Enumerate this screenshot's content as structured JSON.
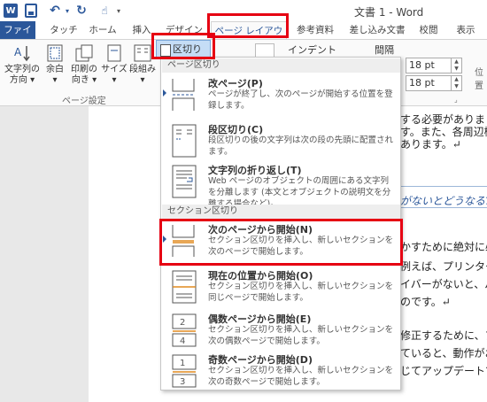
{
  "window": {
    "title": "文書 1 - Word"
  },
  "quick_access": {
    "undo_icon": "undo-icon",
    "redo_icon": "redo-icon",
    "touch_icon": "touch-mode-icon"
  },
  "tabs": [
    {
      "label": "ファイル"
    },
    {
      "label": "タッチ"
    },
    {
      "label": "ホーム"
    },
    {
      "label": "挿入"
    },
    {
      "label": "デザイン"
    },
    {
      "label": "ページ レイアウト"
    },
    {
      "label": "参考資料"
    },
    {
      "label": "差し込み文書"
    },
    {
      "label": "校閲"
    },
    {
      "label": "表示"
    }
  ],
  "ribbon": {
    "text_direction": [
      "文字列の",
      "方向"
    ],
    "margins": "余白",
    "orientation": [
      "印刷の",
      "向き"
    ],
    "size": "サイズ",
    "columns": "段組み",
    "group_label": "ページ設定",
    "breaks_button": "区切り",
    "indent_label": "インデント",
    "spacing_label": "間隔",
    "spacing_before": "18 pt",
    "spacing_after": "18 pt",
    "position_label": "位置"
  },
  "dropdown": {
    "section_page": "ページ区切り",
    "section_section": "セクション区切り",
    "items": [
      {
        "title": "改ページ(P)",
        "desc": "ページが終了し、次のページが開始する位置を登録します。"
      },
      {
        "title": "段区切り(C)",
        "desc": "段区切りの後の文字列は次の段の先頭に配置されます。"
      },
      {
        "title": "文字列の折り返し(T)",
        "desc": "Web ページのオブジェクトの周囲にある文字列を分離します (本文とオブジェクトの説明文を分離する場合など)。"
      },
      {
        "title": "次のページから開始(N)",
        "desc": "セクション区切りを挿入し、新しいセクションを次のページで開始します。"
      },
      {
        "title": "現在の位置から開始(O)",
        "desc": "セクション区切りを挿入し、新しいセクションを同じページで開始します。"
      },
      {
        "title": "偶数ページから開始(E)",
        "desc": "セクション区切りを挿入し、新しいセクションを次の偶数ページで開始します。"
      },
      {
        "title": "奇数ページから開始(D)",
        "desc": "セクション区切りを挿入し、新しいセクションを次の奇数ページで開始します。"
      }
    ]
  },
  "document": {
    "lines": [
      "する必要がありま",
      "す。また、各周辺機",
      "あります。↵",
      "かすために絶対に必",
      "例えば、プリンター",
      "イバーがないと、パ",
      "のです。↵",
      "修正するために、ア",
      "ていると、動作がお",
      "じてアップデートで"
    ],
    "heading": "がないとどうなる?↵"
  },
  "colors": {
    "accent": "#2b579a",
    "highlight": "#e60012"
  }
}
